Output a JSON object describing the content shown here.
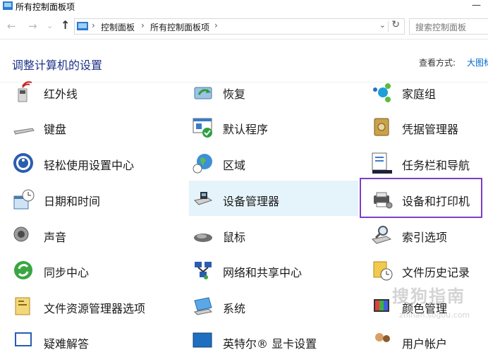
{
  "window": {
    "title": "所有控制面板项",
    "minimize": "—"
  },
  "nav": {
    "back": "←",
    "forward": "→",
    "recent": "⌄",
    "up": "↑",
    "breadcrumb": [
      "控制面板",
      "所有控制面板项"
    ],
    "sep": "›",
    "dropdown": "⌄",
    "refresh": "↻",
    "search_placeholder": "搜索控制面板"
  },
  "header": {
    "title": "调整计算机的设置",
    "view_by_label": "查看方式:",
    "view_by_value": "大图标"
  },
  "items": [
    {
      "label": "红外线",
      "icon": "infrared-icon"
    },
    {
      "label": "恢复",
      "icon": "recovery-icon"
    },
    {
      "label": "家庭组",
      "icon": "homegroup-icon"
    },
    {
      "label": "键盘",
      "icon": "keyboard-icon"
    },
    {
      "label": "默认程序",
      "icon": "default-programs-icon"
    },
    {
      "label": "凭据管理器",
      "icon": "credential-manager-icon"
    },
    {
      "label": "轻松使用设置中心",
      "icon": "ease-of-access-icon"
    },
    {
      "label": "区域",
      "icon": "region-icon"
    },
    {
      "label": "任务栏和导航",
      "icon": "taskbar-icon"
    },
    {
      "label": "日期和时间",
      "icon": "date-time-icon"
    },
    {
      "label": "设备管理器",
      "icon": "device-manager-icon"
    },
    {
      "label": "设备和打印机",
      "icon": "devices-printers-icon"
    },
    {
      "label": "声音",
      "icon": "sound-icon"
    },
    {
      "label": "鼠标",
      "icon": "mouse-icon"
    },
    {
      "label": "索引选项",
      "icon": "indexing-icon"
    },
    {
      "label": "同步中心",
      "icon": "sync-center-icon"
    },
    {
      "label": "网络和共享中心",
      "icon": "network-icon"
    },
    {
      "label": "文件历史记录",
      "icon": "file-history-icon"
    },
    {
      "label": "文件资源管理器选项",
      "icon": "folder-options-icon"
    },
    {
      "label": "系统",
      "icon": "system-icon"
    },
    {
      "label": "颜色管理",
      "icon": "color-management-icon"
    },
    {
      "label": "疑难解答",
      "icon": "troubleshooting-icon"
    },
    {
      "label": "英特尔® 显卡设置",
      "icon": "intel-graphics-icon"
    },
    {
      "label": "用户帐户",
      "icon": "user-accounts-icon"
    }
  ],
  "watermark": {
    "text": "搜狗指南",
    "sub": "zhinan.sogou.com"
  },
  "colors": {
    "heading": "#1e3287",
    "link": "#0066cc",
    "hover": "#e5f3fb",
    "selected_border": "#7b3fc4"
  }
}
